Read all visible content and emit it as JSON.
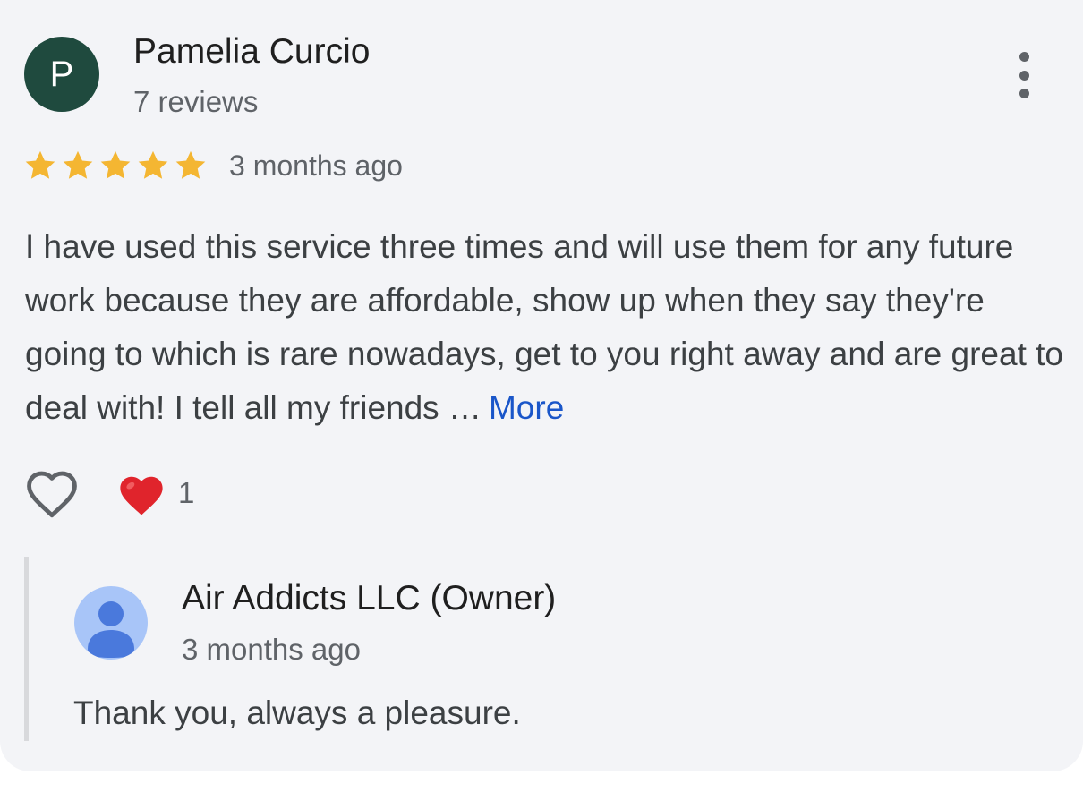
{
  "review": {
    "author_initial": "P",
    "author_name": "Pamelia Curcio",
    "author_reviews": "7 reviews",
    "rating": 5,
    "rating_max": 5,
    "time": "3 months ago",
    "text": "I have used this service three times and will use them for any future work because they are affordable, show up when they say they're going to which is rare nowadays, get to you right away and are great to deal with! I tell all my friends …",
    "more_label": "More",
    "reaction_count": "1"
  },
  "reply": {
    "owner_name": "Air Addicts LLC (Owner)",
    "time": "3 months ago",
    "text": "Thank you, always a pleasure."
  },
  "icons": {
    "menu": "more-vert-icon",
    "star": "star-icon",
    "like": "heart-outline-icon",
    "reaction": "red-heart-icon",
    "owner_avatar": "person-icon"
  },
  "colors": {
    "card_background": "#f3f4f7",
    "avatar_background": "#1f4a3e",
    "star": "#f4b632",
    "link": "#1a56c9",
    "reaction_heart": "#e0242c",
    "owner_avatar_background": "#a8c5f8",
    "owner_avatar_figure": "#4a79dc"
  }
}
